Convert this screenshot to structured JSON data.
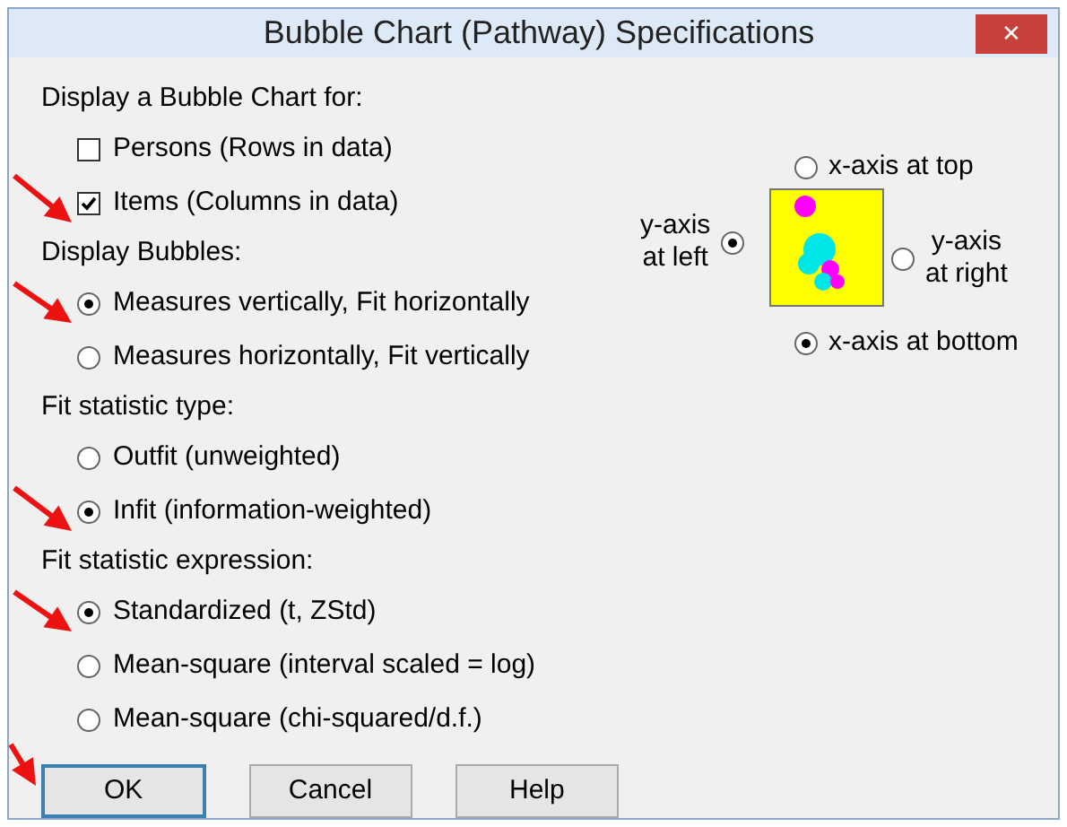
{
  "window": {
    "title": "Bubble Chart (Pathway) Specifications",
    "close": "✕"
  },
  "sections": [
    {
      "heading": "Display a Bubble Chart for:",
      "options": [
        {
          "kind": "checkbox",
          "label": "Persons (Rows in data)",
          "checked": false
        },
        {
          "kind": "checkbox",
          "label": "Items (Columns in data)",
          "checked": true
        }
      ]
    },
    {
      "heading": "Display Bubbles:",
      "options": [
        {
          "kind": "radio",
          "label": "Measures vertically, Fit horizontally",
          "selected": true
        },
        {
          "kind": "radio",
          "label": "Measures horizontally, Fit vertically",
          "selected": false
        }
      ]
    },
    {
      "heading": "Fit statistic type:",
      "options": [
        {
          "kind": "radio",
          "label": "Outfit (unweighted)",
          "selected": false
        },
        {
          "kind": "radio",
          "label": "Infit (information-weighted)",
          "selected": true
        }
      ]
    },
    {
      "heading": "Fit statistic expression:",
      "options": [
        {
          "kind": "radio",
          "label": "Standardized (t, ZStd)",
          "selected": true
        },
        {
          "kind": "radio",
          "label": "Mean-square (interval scaled = log)",
          "selected": false
        },
        {
          "kind": "radio",
          "label": "Mean-square (chi-squared/d.f.)",
          "selected": false
        }
      ]
    }
  ],
  "axes": {
    "top": {
      "label": "x-axis at top",
      "selected": false
    },
    "left": {
      "label": "y-axis at left",
      "selected": true
    },
    "right": {
      "label": "y-axis at right",
      "selected": false
    },
    "bottom": {
      "label": "x-axis at bottom",
      "selected": true
    }
  },
  "buttons": [
    "OK",
    "Cancel",
    "Help"
  ]
}
